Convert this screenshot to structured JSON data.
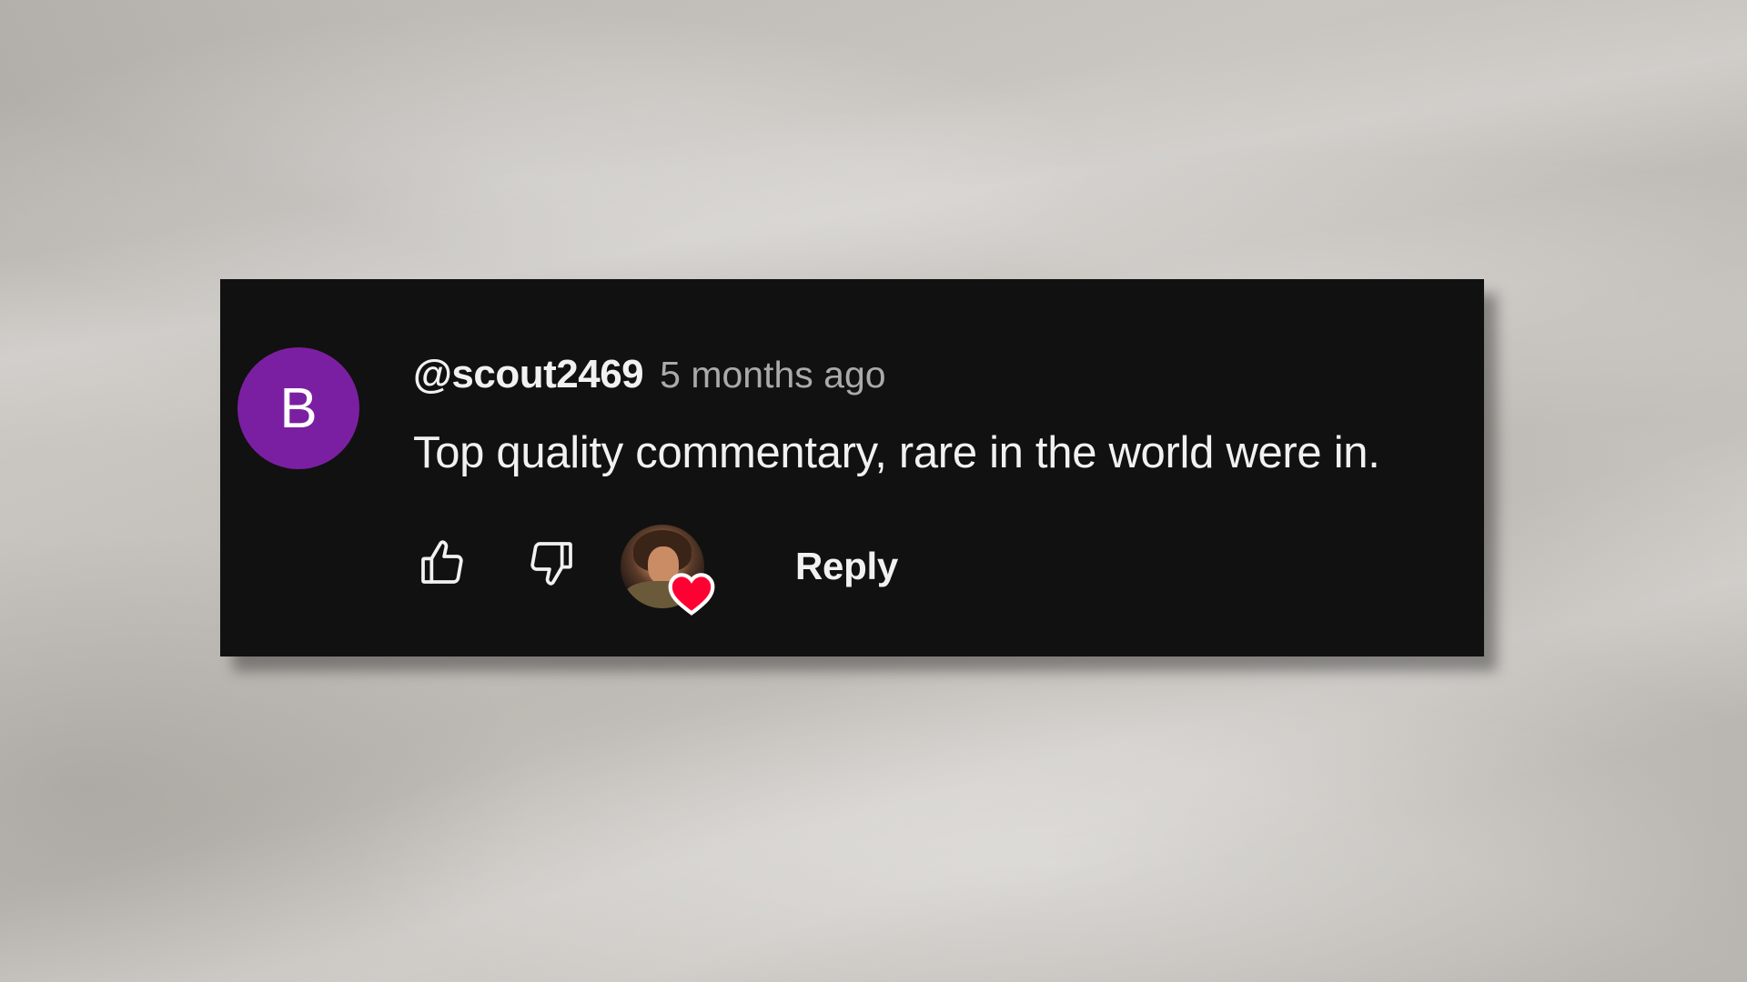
{
  "comment": {
    "avatar_initial": "B",
    "avatar_color": "#7b1fa2",
    "username": "@scout2469",
    "timestamp": "5 months ago",
    "text": "Top quality commentary, rare in the world were in."
  },
  "actions": {
    "like_icon": "thumbs-up-icon",
    "dislike_icon": "thumbs-down-icon",
    "creator_heart_icon": "heart-icon",
    "heart_color": "#ff0033",
    "reply_label": "Reply"
  },
  "colors": {
    "card_background": "#111111",
    "primary_text": "#f1f1f1",
    "secondary_text": "#aaaaaa"
  }
}
